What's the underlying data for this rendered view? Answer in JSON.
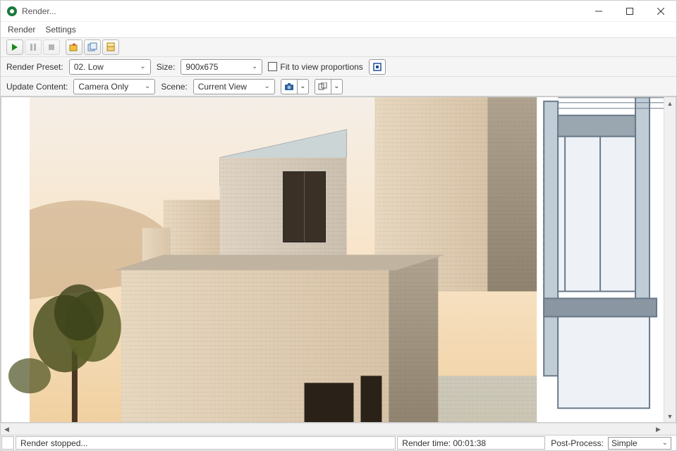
{
  "window": {
    "title": "Render..."
  },
  "menu": {
    "render": "Render",
    "settings": "Settings"
  },
  "options": {
    "render_preset_label": "Render Preset:",
    "render_preset_value": "02. Low",
    "size_label": "Size:",
    "size_value": "900x675",
    "fit_label": "Fit to view proportions",
    "update_content_label": "Update Content:",
    "update_content_value": "Camera Only",
    "scene_label": "Scene:",
    "scene_value": "Current View"
  },
  "status": {
    "state": "Render stopped...",
    "time_label": "Render time:",
    "time_value": "00:01:38",
    "postprocess_label": "Post-Process:",
    "postprocess_value": "Simple"
  }
}
